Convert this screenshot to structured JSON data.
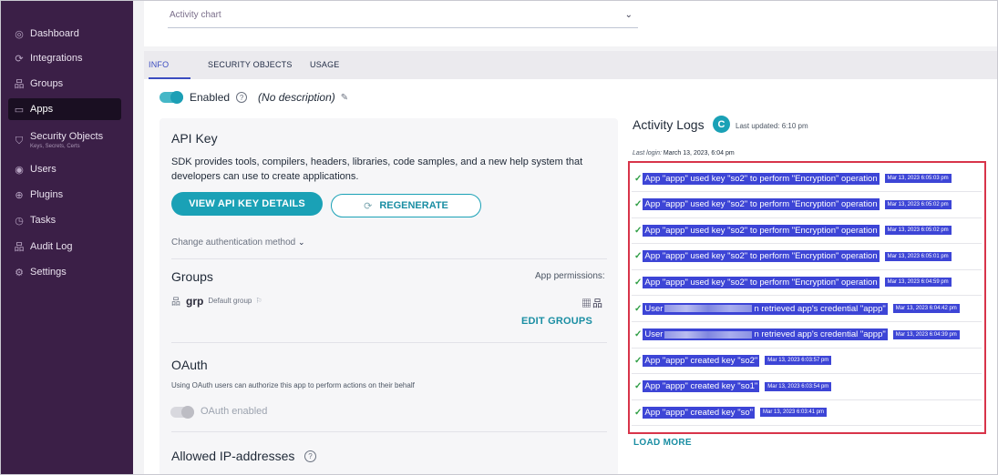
{
  "sidebar": {
    "items": [
      {
        "label": "Dashboard",
        "icon": "dashboard-icon",
        "glyph": "◎"
      },
      {
        "label": "Integrations",
        "icon": "integrations-icon",
        "glyph": "⟳"
      },
      {
        "label": "Groups",
        "icon": "groups-icon",
        "glyph": "品"
      },
      {
        "label": "Apps",
        "icon": "apps-icon",
        "glyph": "▭"
      },
      {
        "label": "Security Objects",
        "sublabel": "Keys, Secrets, Certs",
        "icon": "security-objects-icon",
        "glyph": "⛉"
      },
      {
        "label": "Users",
        "icon": "users-icon",
        "glyph": "◉"
      },
      {
        "label": "Plugins",
        "icon": "plugins-icon",
        "glyph": "⊕"
      },
      {
        "label": "Tasks",
        "icon": "tasks-icon",
        "glyph": "◷"
      },
      {
        "label": "Audit Log",
        "icon": "audit-log-icon",
        "glyph": "品"
      },
      {
        "label": "Settings",
        "icon": "settings-icon",
        "glyph": "⚙"
      }
    ],
    "active": "Apps"
  },
  "topbar": {
    "chart_select": "Activity chart"
  },
  "tabs": [
    {
      "label": "INFO"
    },
    {
      "label": "SECURITY OBJECTS"
    },
    {
      "label": "USAGE"
    }
  ],
  "status": {
    "enabled_label": "Enabled",
    "description": "(No description)"
  },
  "api_key": {
    "title": "API Key",
    "text": "SDK provides tools, compilers, headers, libraries, code samples, and a new help system that developers can use to create applications.",
    "view_button": "VIEW API KEY DETAILS",
    "regenerate_button": "REGENERATE",
    "change_auth": "Change authentication method"
  },
  "groups": {
    "title": "Groups",
    "permissions_label": "App permissions:",
    "group_name": "grp",
    "group_default": "Default group",
    "edit_button": "EDIT GROUPS"
  },
  "oauth": {
    "title": "OAuth",
    "text": "Using OAuth users can authorize this app to perform actions on their behalf",
    "toggle_label": "OAuth enabled"
  },
  "allowed_ip": {
    "title": "Allowed IP-addresses"
  },
  "activity_logs": {
    "title": "Activity Logs",
    "last_updated": "Last updated: 6:10 pm",
    "last_login_label": "Last login:",
    "last_login_value": "March 13, 2023, 6:04 pm",
    "load_more": "LOAD MORE",
    "entries": [
      {
        "pre": "App \"appp\" used key \"so2\" to perform \"Encryption\" operation",
        "post": "",
        "redacted": false,
        "time": "Mar 13, 2023 6:05:03 pm"
      },
      {
        "pre": "App \"appp\" used key \"so2\" to perform \"Encryption\" operation",
        "post": "",
        "redacted": false,
        "time": "Mar 13, 2023 6:05:02 pm"
      },
      {
        "pre": "App \"appp\" used key \"so2\" to perform \"Encryption\" operation",
        "post": "",
        "redacted": false,
        "time": "Mar 13, 2023 6:05:02 pm"
      },
      {
        "pre": "App \"appp\" used key \"so2\" to perform \"Encryption\" operation",
        "post": "",
        "redacted": false,
        "time": "Mar 13, 2023 6:05:01 pm"
      },
      {
        "pre": "App \"appp\" used key \"so2\" to perform \"Encryption\" operation",
        "post": "",
        "redacted": false,
        "time": "Mar 13, 2023 6:04:59 pm"
      },
      {
        "pre": "User",
        "post": "n retrieved app's credential \"appp\"",
        "redacted": true,
        "time": "Mar 13, 2023 6:04:42 pm"
      },
      {
        "pre": "User",
        "post": "n retrieved app's credential \"appp\"",
        "redacted": true,
        "time": "Mar 13, 2023 6:04:39 pm"
      },
      {
        "pre": "App \"appp\" created key \"so2\"",
        "post": "",
        "redacted": false,
        "time": "Mar 13, 2023 6:03:57 pm"
      },
      {
        "pre": "App \"appp\" created key \"so1\"",
        "post": "",
        "redacted": false,
        "time": "Mar 13, 2023 6:03:54 pm"
      },
      {
        "pre": "App \"appp\" created key \"so\"",
        "post": "",
        "redacted": false,
        "time": "Mar 13, 2023 6:03:41 pm"
      }
    ]
  },
  "colors": {
    "sidebar": "#3b1f47",
    "accent": "#1aa1b6",
    "highlight": "#3d45d6",
    "box_border": "#d8344a"
  }
}
